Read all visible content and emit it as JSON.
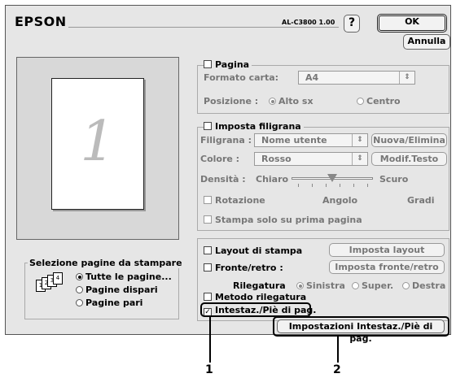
{
  "header": {
    "brand": "EPSON",
    "model": "AL-C3800 1.00",
    "help": "?",
    "ok_label": "OK",
    "cancel_label": "Annulla"
  },
  "preview": {
    "page_number": "1"
  },
  "page_selection": {
    "title": "Selezione pagine da stampare",
    "options": [
      "Tutte le pagine...",
      "Pagine dispari",
      "Pagine pari"
    ],
    "selected": "Tutte le pagine...",
    "icon_digits": [
      "1",
      "2",
      "3",
      "4"
    ]
  },
  "pagina": {
    "title": "Pagina",
    "paper_size_label": "Formato carta:",
    "paper_size_value": "A4",
    "position_label": "Posizione :",
    "position_options": [
      "Alto sx",
      "Centro"
    ],
    "position_selected": "Alto sx"
  },
  "watermark": {
    "title": "Imposta filigrana",
    "filigrana_label": "Filigrana :",
    "filigrana_value": "Nome utente",
    "new_delete_button": "Nuova/Elimina",
    "color_label": "Colore :",
    "color_value": "Rosso",
    "modify_text_button": "Modif.Testo",
    "density_label": "Densità :",
    "density_low": "Chiaro",
    "density_high": "Scuro",
    "density_level": 0.5,
    "rotation_label": "Rotazione",
    "angle_label": "Angolo",
    "degrees_label": "Gradi",
    "first_page_only_label": "Stampa solo su prima pagina"
  },
  "layout": {
    "print_layout_label": "Layout di stampa",
    "print_layout_button": "Imposta layout",
    "duplex_label": "Fronte/retro :",
    "duplex_button": "Imposta fronte/retro",
    "binding_label": "Rilegatura",
    "binding_options": [
      "Sinistra",
      "Super.",
      "Destra"
    ],
    "binding_selected": "Sinistra",
    "binding_method_label": "Metodo rilegatura",
    "header_footer_label": "Intestaz./Piè di pag.",
    "header_footer_checked": true,
    "header_footer_button": "Impostazioni Intestaz./Piè di pag."
  },
  "callouts": [
    "1",
    "2"
  ]
}
